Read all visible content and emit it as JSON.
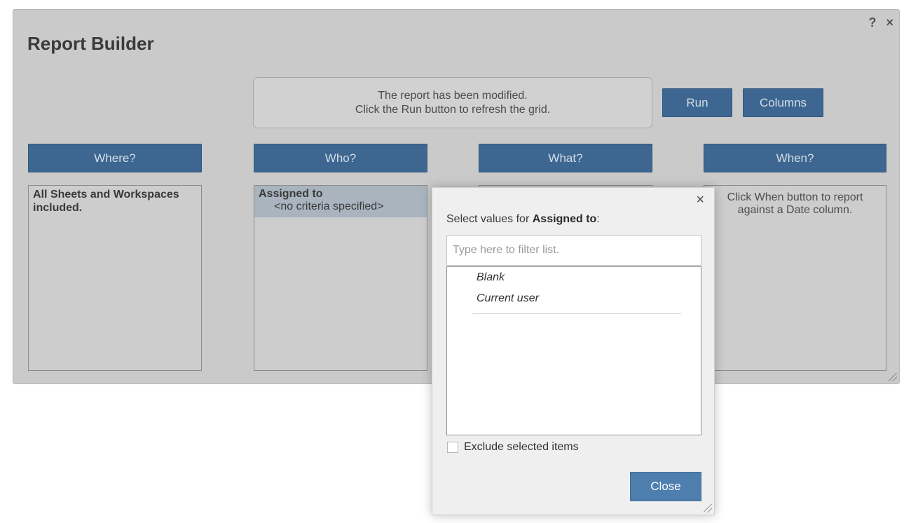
{
  "builder": {
    "title": "Report Builder",
    "help_icon": "?",
    "close_icon": "×",
    "notice_line1": "The report has been modified.",
    "notice_line2": "Click the Run button to refresh the grid.",
    "run_label": "Run",
    "columns_label": "Columns",
    "where_label": "Where?",
    "who_label": "Who?",
    "what_label": "What?",
    "when_label": "When?",
    "where_text": "All Sheets and Workspaces included.",
    "who_item_label": "Assigned to",
    "who_item_sub": "<no criteria specified>",
    "when_text": "Click When button to report against a Date column."
  },
  "popup": {
    "close_icon": "×",
    "prompt_prefix": "Select values for ",
    "prompt_field": "Assigned to",
    "prompt_suffix": ":",
    "filter_placeholder": "Type here to filter list.",
    "filter_value": "",
    "items": [
      {
        "label": "Blank"
      },
      {
        "label": "Current user"
      }
    ],
    "exclude_label": "Exclude selected items",
    "exclude_checked": false,
    "close_label": "Close"
  },
  "colors": {
    "primary_button": "#3d6791",
    "close_button": "#4d7eae",
    "dialog_background": "#cacaca",
    "popup_background": "#efefef"
  }
}
